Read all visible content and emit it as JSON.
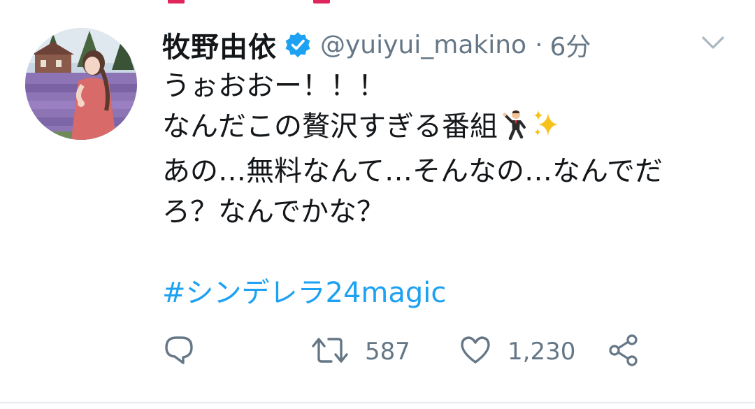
{
  "tweet": {
    "author": {
      "display_name": "牧野由依",
      "handle": "@yuiyui_makino",
      "verified": true
    },
    "separator": "·",
    "timestamp": "6分",
    "text_lines": [
      "うぉおおー！！！",
      "なんだこの贅沢すぎる番組",
      "あの…無料なんて…そんなの…なんでだ",
      "ろ？なんでかな？"
    ],
    "line2_emojis": [
      "man-dancing-emoji",
      "sparkles-emoji"
    ],
    "hashtag": "#シンデレラ24magic",
    "actions": {
      "reply_icon": "reply-icon",
      "retweet_icon": "retweet-icon",
      "retweet_count": "587",
      "like_icon": "heart-icon",
      "like_count": "1,230",
      "share_icon": "share-icon"
    }
  },
  "colors": {
    "link": "#1da1f2",
    "secondary_text": "#657786",
    "primary_text": "#14171a",
    "verified": "#1da1f2",
    "top_marks": "#e0245e"
  }
}
